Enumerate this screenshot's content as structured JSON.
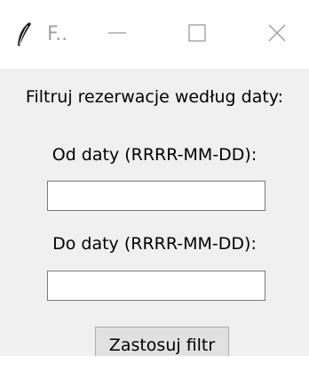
{
  "window": {
    "title": "F..",
    "icon": "feather-icon",
    "controls": {
      "minimize_icon": "minimize-icon",
      "maximize_icon": "maximize-icon",
      "close_icon": "close-icon"
    }
  },
  "form": {
    "heading": "Filtruj rezerwacje według daty:",
    "from_label": "Od daty (RRRR-MM-DD):",
    "from_value": "",
    "to_label": "Do daty (RRRR-MM-DD):",
    "to_value": "",
    "apply_button": "Zastosuj filtr"
  }
}
